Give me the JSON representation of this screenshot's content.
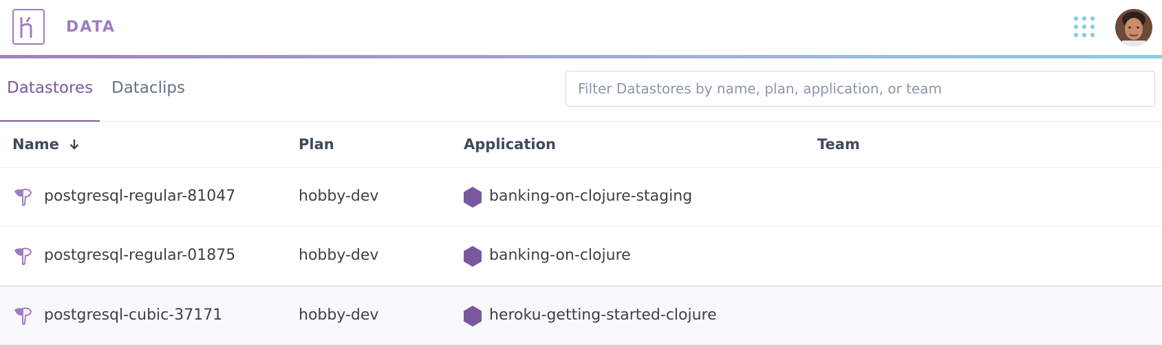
{
  "header": {
    "brand": "DATA",
    "logo_icon": "heroku-logo-icon",
    "apps_icon": "apps-grid-icon",
    "accent_color": "#79589f"
  },
  "tabs": [
    {
      "label": "Datastores",
      "active": true
    },
    {
      "label": "Dataclips",
      "active": false
    }
  ],
  "filter": {
    "placeholder": "Filter Datastores by name, plan, application, or team",
    "value": ""
  },
  "table": {
    "columns": {
      "name": "Name",
      "plan": "Plan",
      "application": "Application",
      "team": "Team"
    },
    "sort": {
      "column": "name",
      "direction": "descending-arrow-icon"
    },
    "rows": [
      {
        "name": "postgresql-regular-81047",
        "plan": "hobby-dev",
        "application": "banking-on-clojure-staging",
        "team": ""
      },
      {
        "name": "postgresql-regular-01875",
        "plan": "hobby-dev",
        "application": "banking-on-clojure",
        "team": ""
      },
      {
        "name": "postgresql-cubic-37171",
        "plan": "hobby-dev",
        "application": "heroku-getting-started-clojure",
        "team": ""
      }
    ]
  }
}
